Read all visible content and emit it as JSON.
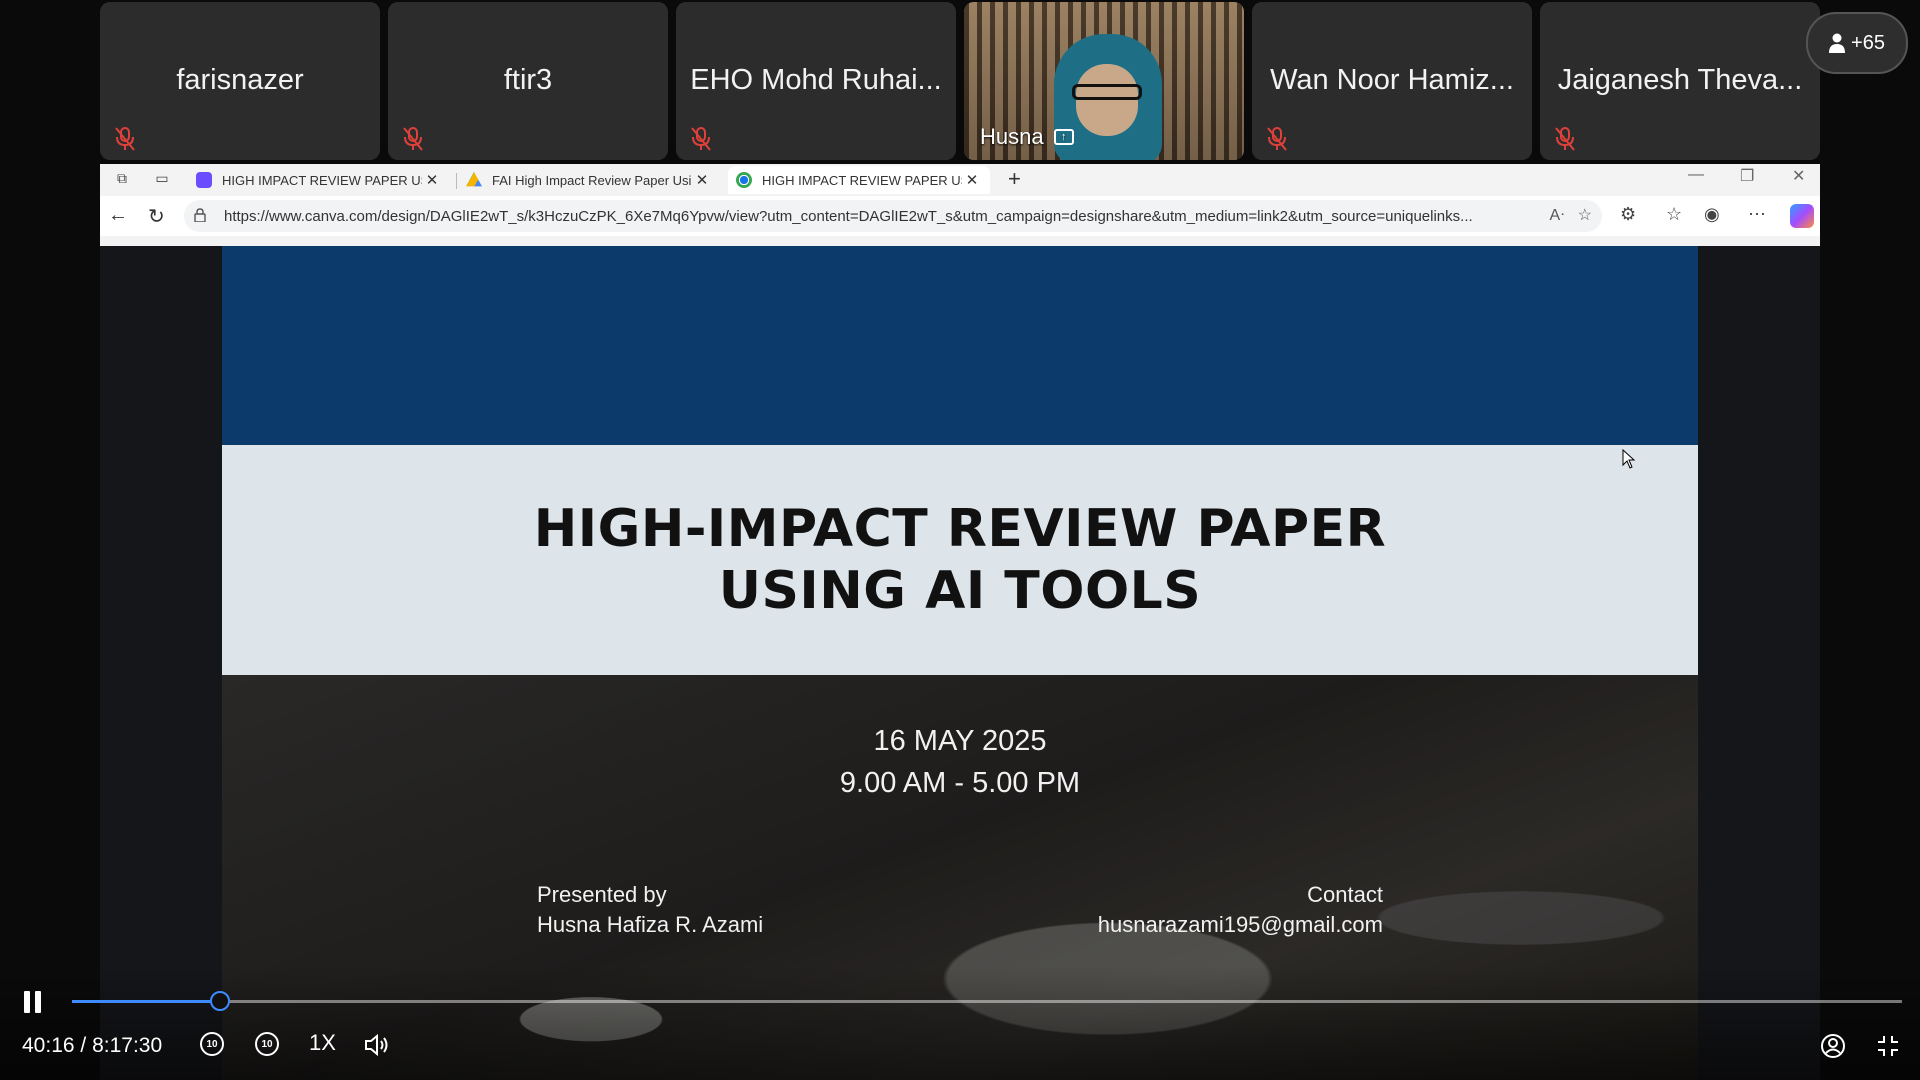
{
  "participants": [
    {
      "name": "farisnazer",
      "muted": true
    },
    {
      "name": "ftir3",
      "muted": true
    },
    {
      "name": "EHO Mohd Ruhai...",
      "muted": true
    },
    {
      "name": "Husna",
      "video": true,
      "sharing": true
    },
    {
      "name": "Wan Noor Hamiz...",
      "muted": true
    },
    {
      "name": "Jaiganesh Theva...",
      "muted": true
    }
  ],
  "more_participants": "+65",
  "browser": {
    "tabs": [
      {
        "label": "HIGH IMPACT REVIEW PAPER USI",
        "favicon_color": "#6c4cff"
      },
      {
        "label": "FAI High Impact Review Paper Usi",
        "favicon_color": "#f4b400"
      },
      {
        "label": "HIGH IMPACT REVIEW PAPER USI",
        "favicon_color": "#1a73e8",
        "active": true
      }
    ],
    "url": "https://www.canva.com/design/DAGlIE2wT_s/k3HczuCzPK_6Xe7Mq6Ypvw/view?utm_content=DAGlIE2wT_s&utm_campaign=designshare&utm_medium=link2&utm_source=uniquelinks..."
  },
  "slide": {
    "title_line1": "HIGH-IMPACT REVIEW PAPER",
    "title_line2": "USING AI TOOLS",
    "date": "16 MAY 2025",
    "time": "9.00 AM - 5.00 PM",
    "presented_by_label": "Presented by",
    "presenter": "Husna Hafiza R. Azami",
    "contact_label": "Contact",
    "contact_email": "husnarazami195@gmail.com",
    "colors": {
      "top_band": "#0b3a6b",
      "title_band": "#dde4ea"
    }
  },
  "player": {
    "current_time": "40:16",
    "separator": "/",
    "total_time": "8:17:30",
    "progress_fraction": 0.0809,
    "speed": "1X",
    "skip_seconds": "10"
  }
}
